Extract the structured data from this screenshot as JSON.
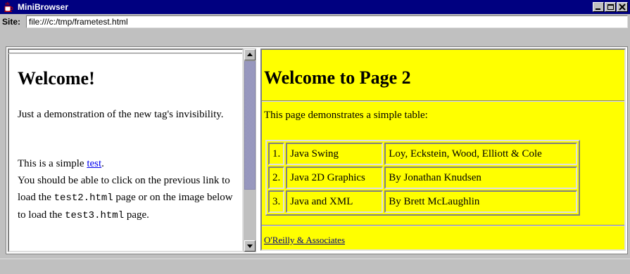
{
  "window": {
    "title": "MiniBrowser",
    "icon": "java-coffee-cup-icon"
  },
  "site": {
    "label": "Site:",
    "url": "file:///c:/tmp/frametest.html"
  },
  "left_frame": {
    "heading": "Welcome!",
    "intro": "Just a demonstration of the new tag's invisibility.",
    "line1_prefix": "This is a simple ",
    "link_text": "test",
    "line1_suffix": ".",
    "line2_a": "You should be able to click on the previous link to load the ",
    "file1": "test2.html",
    "line2_b": " page or on the image below to load the ",
    "file2": "test3.html",
    "line2_c": " page."
  },
  "right_frame": {
    "heading": "Welcome to Page 2",
    "intro": "This page demonstrates a simple table:",
    "table": [
      [
        "1.",
        "Java Swing",
        "Loy, Eckstein, Wood, Elliott & Cole"
      ],
      [
        "2.",
        "Java 2D Graphics",
        "By Jonathan Knudsen"
      ],
      [
        "3.",
        "Java and XML",
        "By Brett McLaughlin"
      ]
    ],
    "footer_link": "O'Reilly & Associates"
  }
}
